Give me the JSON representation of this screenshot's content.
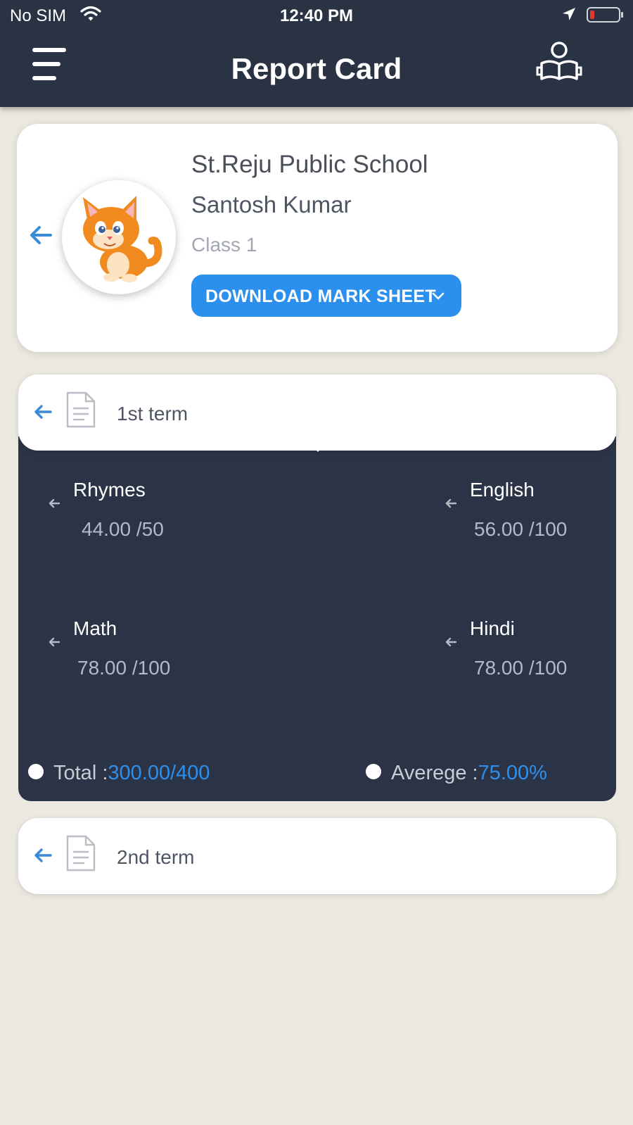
{
  "status_bar": {
    "carrier": "No SIM",
    "time": "12:40 PM",
    "battery_color": "#e2372f"
  },
  "nav": {
    "title": "Report Card",
    "menu_icon": "hamburger-menu-icon",
    "right_icon": "student-reading-book-icon"
  },
  "profile": {
    "school": "St.Reju Public School",
    "student": "Santosh Kumar",
    "class": "Class 1",
    "avatar": "cartoon-cat-avatar",
    "download_button": "DOWNLOAD MARK SHEET"
  },
  "terms": [
    {
      "label": "1st term",
      "expanded": true,
      "subjects": [
        {
          "name": "Rhymes",
          "score": "44.00  /50"
        },
        {
          "name": "English",
          "score": "56.00 /100"
        },
        {
          "name": "Math",
          "score": "78.00 /100"
        },
        {
          "name": "Hindi",
          "score": "78.00 /100"
        }
      ],
      "total_label": "Total :",
      "total_value": "300.00/400",
      "average_label": "Averege :",
      "average_value": "75.00%"
    },
    {
      "label": "2nd term",
      "expanded": false
    }
  ],
  "colors": {
    "header_bg": "#2a3344",
    "panel_bg": "#2b3447",
    "accent": "#2b8fee",
    "page_bg": "#eae8df"
  }
}
